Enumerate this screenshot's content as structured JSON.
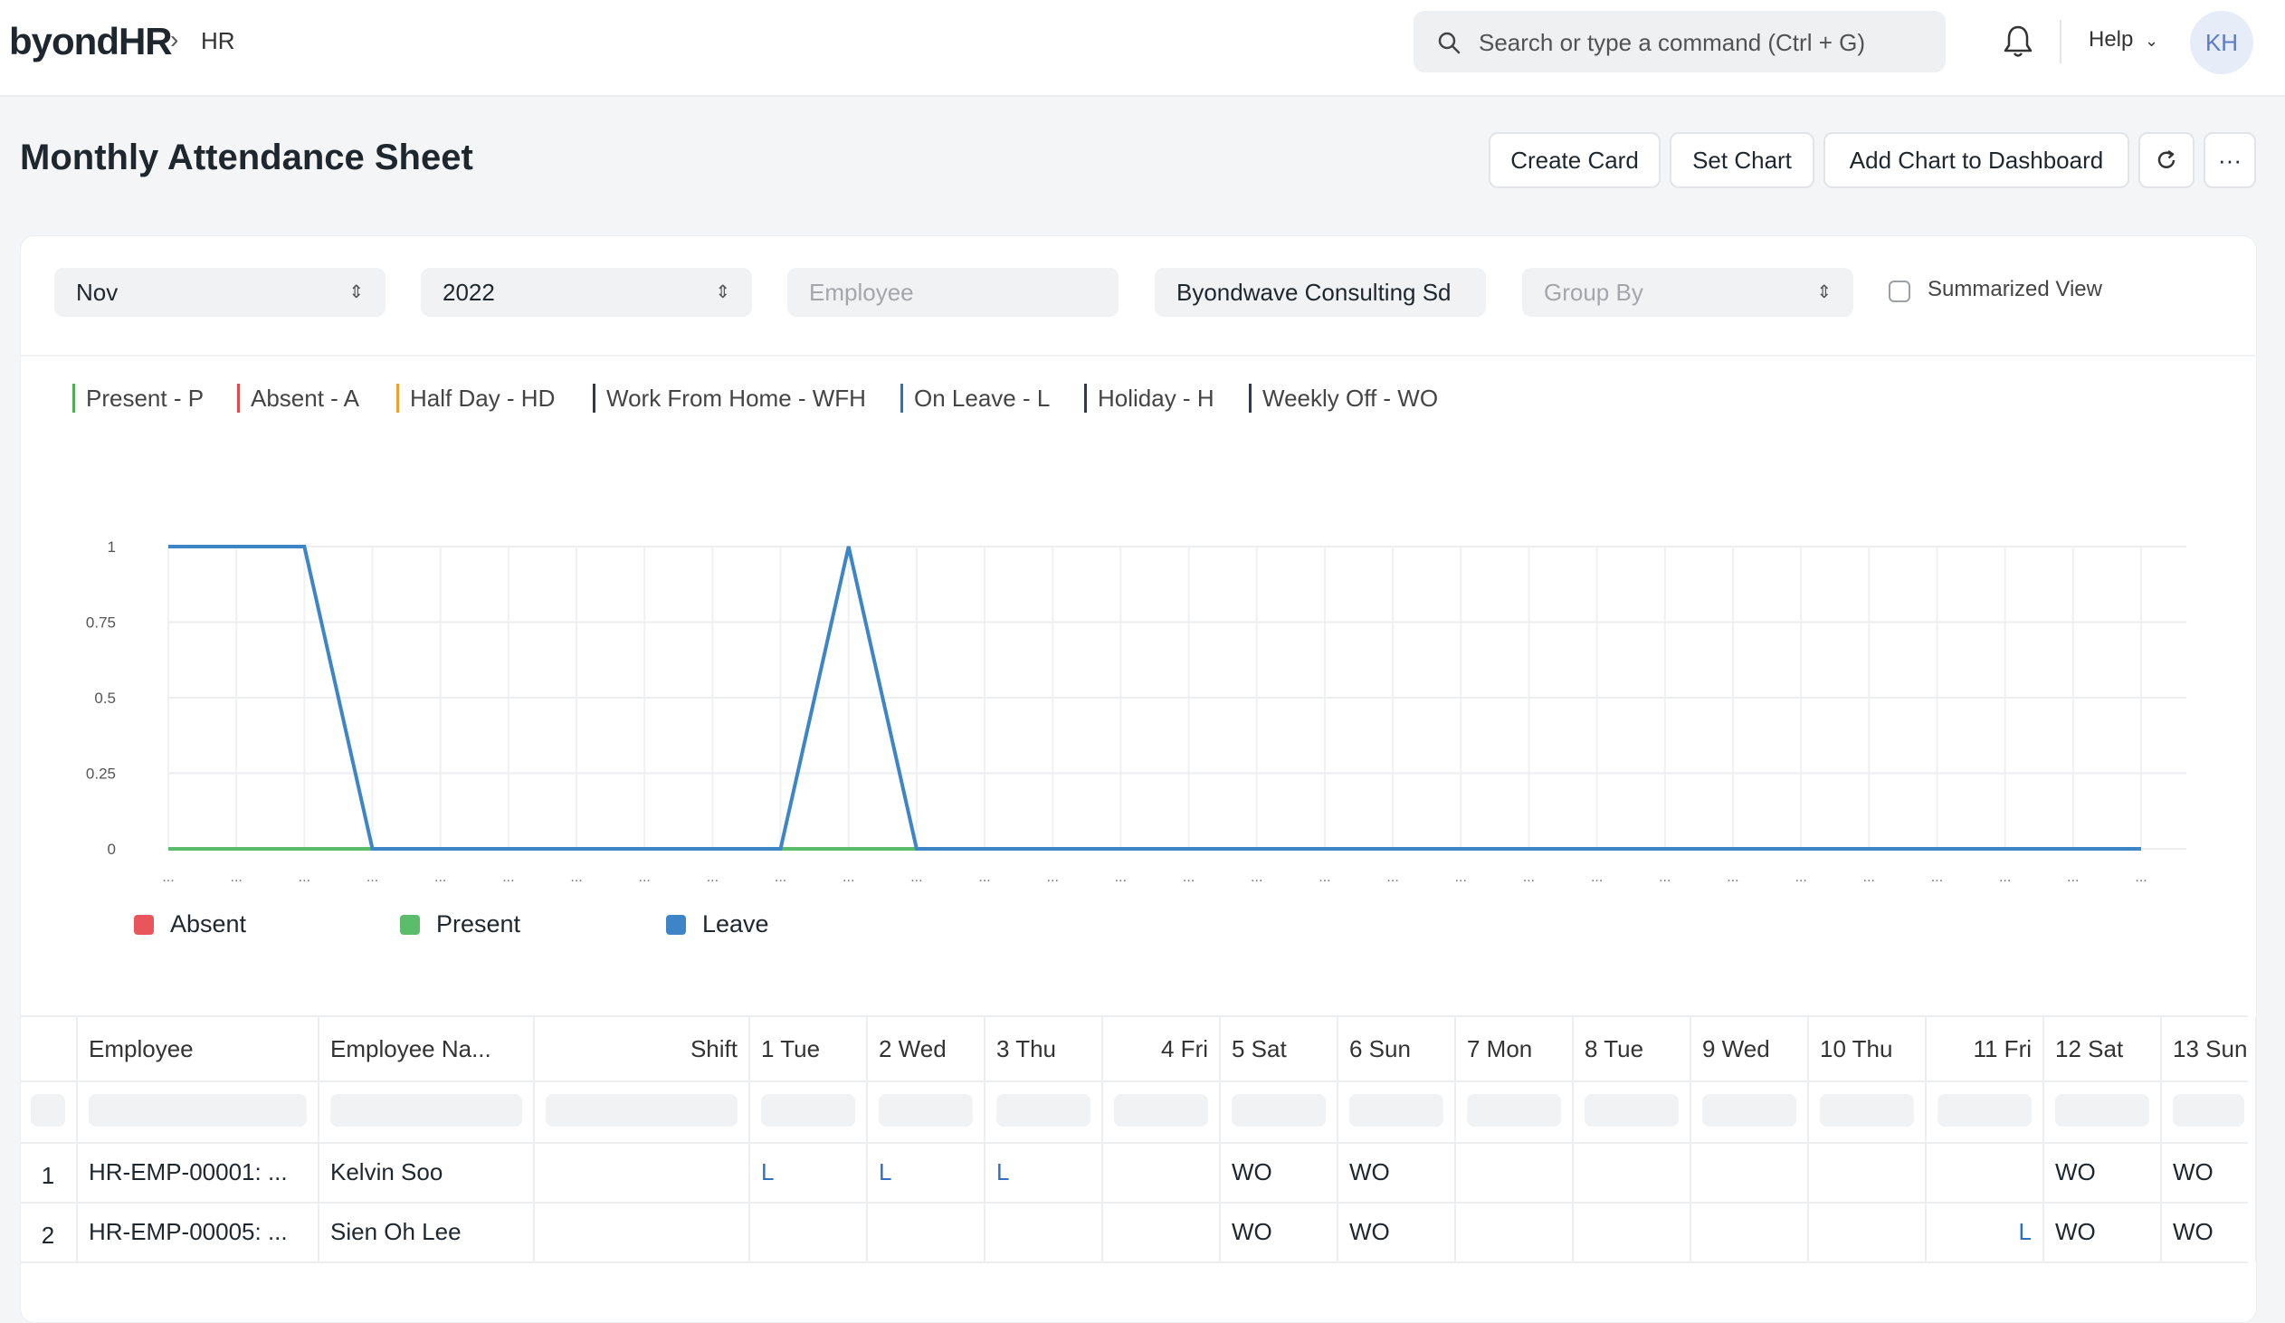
{
  "nav": {
    "brand": "byondHR",
    "breadcrumb": "HR",
    "search_placeholder": "Search or type a command (Ctrl + G)",
    "help": "Help",
    "avatar_initials": "KH"
  },
  "page": {
    "title": "Monthly Attendance Sheet",
    "buttons": {
      "create_card": "Create Card",
      "set_chart": "Set Chart",
      "add_to_dashboard": "Add Chart to Dashboard",
      "more": "···"
    }
  },
  "filters": {
    "month": "Nov",
    "year": "2022",
    "employee_placeholder": "Employee",
    "company": "Byondwave Consulting Sd",
    "group_by_placeholder": "Group By",
    "summarized_view": "Summarized View"
  },
  "status_legend": [
    {
      "label": "Present - P",
      "color": "#4caf50"
    },
    {
      "label": "Absent - A",
      "color": "#e24c4c"
    },
    {
      "label": "Half Day - HD",
      "color": "#f0a030"
    },
    {
      "label": "Work From Home - WFH",
      "color": "#2f3a46"
    },
    {
      "label": "On Leave - L",
      "color": "#2f6fc4"
    },
    {
      "label": "Holiday - H",
      "color": "#2f3a46"
    },
    {
      "label": "Weekly Off - WO",
      "color": "#2f3a46"
    }
  ],
  "chart_data": {
    "type": "line",
    "x": [
      "...",
      "...",
      "...",
      "...",
      "...",
      "...",
      "...",
      "...",
      "...",
      "...",
      "...",
      "...",
      "...",
      "...",
      "...",
      "...",
      "...",
      "...",
      "...",
      "...",
      "...",
      "...",
      "...",
      "...",
      "...",
      "...",
      "...",
      "...",
      "...",
      "..."
    ],
    "y_ticks": [
      "0",
      "0.25",
      "0.5",
      "0.75",
      "1"
    ],
    "ylim": [
      0,
      1
    ],
    "grid": true,
    "legend_position": "bottom-left",
    "series": [
      {
        "name": "Absent",
        "color": "#e8555b",
        "values": [
          0,
          0,
          0,
          0,
          0,
          0,
          0,
          0,
          0,
          0,
          0,
          0,
          0,
          0,
          0,
          0,
          0,
          0,
          0,
          0,
          0,
          0,
          0,
          0,
          0,
          0,
          0,
          0,
          0,
          0
        ]
      },
      {
        "name": "Present",
        "color": "#5bbd6b",
        "values": [
          0,
          0,
          0,
          0,
          0,
          0,
          0,
          0,
          0,
          0,
          0,
          0,
          0,
          0,
          0,
          0,
          0,
          0,
          0,
          0,
          0,
          0,
          0,
          0,
          0,
          0,
          0,
          0,
          0,
          0
        ]
      },
      {
        "name": "Leave",
        "color": "#3d85c6",
        "values": [
          1,
          1,
          1,
          0,
          0,
          0,
          0,
          0,
          0,
          0,
          1,
          0,
          0,
          0,
          0,
          0,
          0,
          0,
          0,
          0,
          0,
          0,
          0,
          0,
          0,
          0,
          0,
          0,
          0,
          0
        ]
      }
    ]
  },
  "table": {
    "columns": [
      "",
      "Employee",
      "Employee Na...",
      "Shift",
      "1 Tue",
      "2 Wed",
      "3 Thu",
      "4 Fri",
      "5 Sat",
      "6 Sun",
      "7 Mon",
      "8 Tue",
      "9 Wed",
      "10 Thu",
      "11 Fri",
      "12 Sat",
      "13 Sun"
    ],
    "rows": [
      [
        "1",
        "HR-EMP-00001: ...",
        "Kelvin Soo",
        "",
        "L",
        "L",
        "L",
        "",
        "WO",
        "WO",
        "",
        "",
        "",
        "",
        "",
        "WO",
        "WO"
      ],
      [
        "2",
        "HR-EMP-00005: ...",
        "Sien Oh Lee",
        "",
        "",
        "",
        "",
        "",
        "WO",
        "WO",
        "",
        "",
        "",
        "",
        "L",
        "WO",
        "WO"
      ]
    ]
  }
}
